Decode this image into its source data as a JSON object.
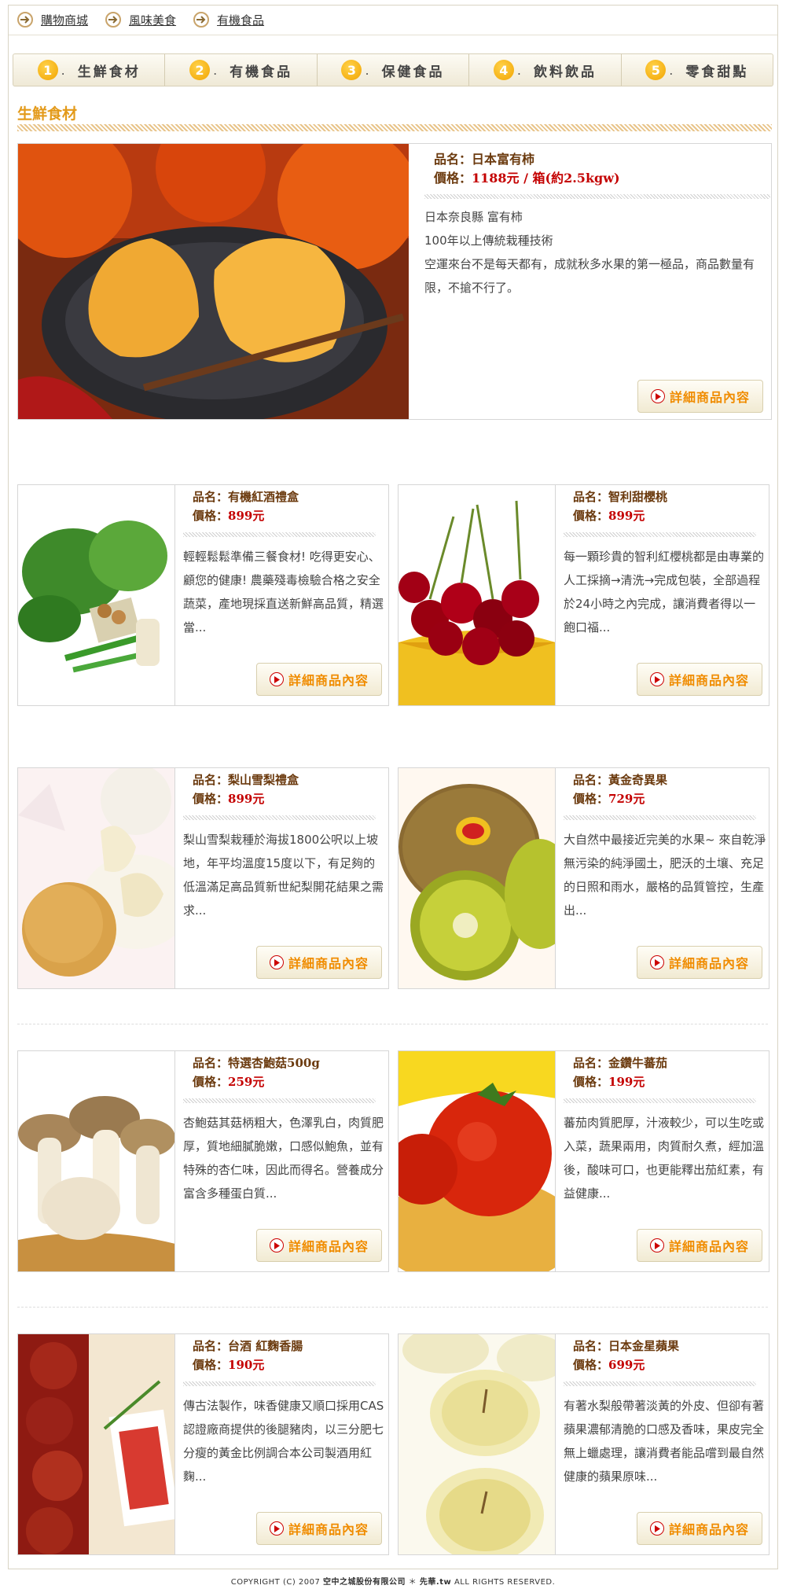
{
  "breadcrumb": [
    "購物商城",
    "風味美食",
    "有機食品"
  ],
  "nav": [
    {
      "num": "1",
      "label": "生鮮食材"
    },
    {
      "num": "2",
      "label": "有機食品"
    },
    {
      "num": "3",
      "label": "保健食品"
    },
    {
      "num": "4",
      "label": "飲料飲品"
    },
    {
      "num": "5",
      "label": "零食甜點"
    }
  ],
  "section_title": "生鮮食材",
  "name_prefix": "品名：",
  "price_prefix": "價格：",
  "detail_label": "詳細商品內容",
  "featured": {
    "name": "日本富有柿",
    "price": "1188元 / 箱(約2.5kgw)",
    "desc": [
      "日本奈良縣 富有柿",
      "100年以上傳統栽種技術",
      "空運來台不是每天都有，成就秋多水果的第一極品，商品數量有限，不搶不行了。"
    ],
    "image": "persimmon-photo"
  },
  "products": [
    {
      "name": "有機紅酒禮盒",
      "price": "899元",
      "desc": "輕輕鬆鬆準備三餐食材! 吃得更安心、顧您的健康! 農藥殘毒檢驗合格之安全蔬菜，產地現採直送新鮮高品質，精選當...",
      "image": "vegetables-photo"
    },
    {
      "name": "智利甜櫻桃",
      "price": "899元",
      "desc": "每一顆珍貴的智利紅櫻桃都是由專業的人工採摘→清洗→完成包裝，全部過程於24小時之內完成，讓消費者得以一飽口福...",
      "image": "cherries-photo"
    },
    {
      "name": "梨山雪梨禮盒",
      "price": "899元",
      "desc": "梨山雪梨栽種於海拔1800公呎以上坡地，年平均溫度15度以下，有足夠的低溫滿足高品質新世紀梨開花結果之需求...",
      "image": "pear-photo"
    },
    {
      "name": "黃金奇異果",
      "price": "729元",
      "desc": "大自然中最接近完美的水果~ 來自乾淨無污染的純淨國土，肥沃的土壤、充足的日照和雨水，嚴格的品質管控，生產出...",
      "image": "kiwi-photo"
    },
    {
      "name": "特選杏鮑菇500g",
      "price": "259元",
      "desc": "杏鮑菇其菇柄粗大，色澤乳白，肉質肥厚，質地細膩脆嫩，口感似鮑魚，並有特殊的杏仁味，因此而得名。營養成分富含多種蛋白質...",
      "image": "mushroom-photo"
    },
    {
      "name": "金鑽牛蕃茄",
      "price": "199元",
      "desc": "蕃茄肉質肥厚，汁液較少，可以生吃或入菜，蔬果兩用，肉質耐久煮，經加溫後，酸味可口，也更能釋出茄紅素，有益健康...",
      "image": "tomato-photo"
    },
    {
      "name": "台酒 紅麴香腸",
      "price": "190元",
      "desc": "傳古法製作，味香健康又順口採用CAS認證廠商提供的後腿豬肉，以三分肥七分瘦的黃金比例調合本公司製酒用紅麴...",
      "image": "sausage-photo"
    },
    {
      "name": "日本金星蘋果",
      "price": "699元",
      "desc": "有著水梨般帶著淡黃的外皮、但卻有著蘋果濃郁清脆的口感及香味，果皮完全無上蠟處理，讓消費者能品嚐到最自然健康的蘋果原味...",
      "image": "apple-photo"
    }
  ],
  "footer": {
    "copyright": "COPYRIGHT (C) 2007",
    "company": "空中之城股份有限公司",
    "separator": "＊",
    "site": "先華.tw",
    "rights": "ALL RIGHTS RESERVED."
  }
}
